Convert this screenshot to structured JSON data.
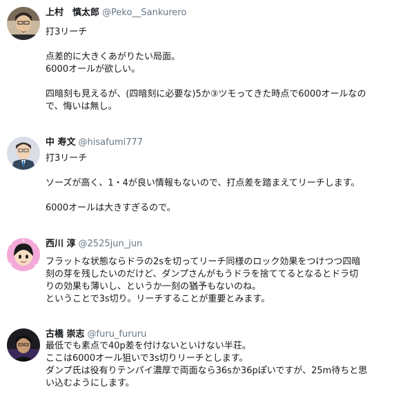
{
  "tweets": [
    {
      "name": "上村　慎太郎",
      "handle": "@Peko__Sankurero",
      "lines": [
        "打3リーチ",
        "",
        "点差的に大きくあがりたい局面。",
        "6000オールが欲しい。",
        "",
        "四暗刻も見えるが、(四暗刻に必要な)5か③ツモってきた時点で6000オールなの",
        "で、悔いは無し。"
      ]
    },
    {
      "name": "中 寿文",
      "handle": "@hisafumi777",
      "lines": [
        "打3リーチ",
        "",
        "ソーズが高く、1・4が良い情報もないので、打点差を踏まえてリーチします。",
        "",
        "6000オールは大きすぎるので。"
      ]
    },
    {
      "name": "西川 淳",
      "handle": "@2525jun_jun",
      "lines": [
        "フラットな状態ならドラの2sを切ってリーチ同様のロック効果をつけつつ四暗",
        "刻の芽を残したいのだけど、ダンプさんがもうドラを捨ててるとなるとドラ切",
        "りの効果も薄いし、というか一刻の猶予もないのね。",
        "ということで3s切り。リーチすることが重要とみます。"
      ]
    },
    {
      "name": "古橋 崇志",
      "handle": "@furu_fururu",
      "lines": [
        "最低でも素点で40p差を付けないといけない半荘。",
        "ここは6000オール狙いで3s切りリーチとします。",
        "ダンプ氏は役有りテンパイ濃厚で両面なら36sか36pぽいですが、25m待ちと思",
        "い込むようにします。"
      ]
    }
  ]
}
